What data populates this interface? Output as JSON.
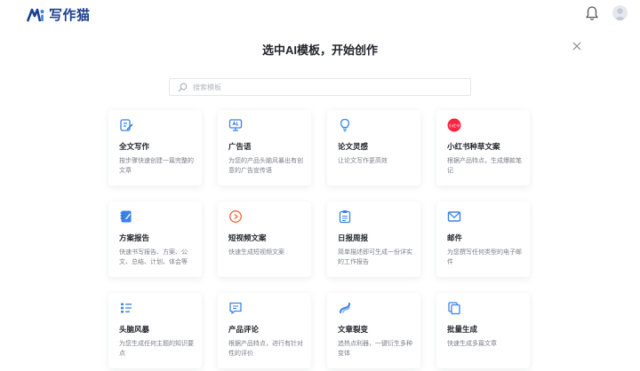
{
  "brand": {
    "name": "写作猫"
  },
  "header": {
    "icons": [
      "bell-icon",
      "user-avatar"
    ]
  },
  "dialog": {
    "title": "选中AI模板，开始创作",
    "close_icon": "close-icon"
  },
  "search": {
    "placeholder": "搜索模板",
    "value": ""
  },
  "colors": {
    "brand_blue": "#1d3f8f",
    "accent_blue": "#3b82e6",
    "card_title": "#1f2329",
    "card_desc": "#7b808a"
  },
  "templates": [
    {
      "icon": "document-edit-icon",
      "title": "全文写作",
      "desc": "按步骤快速创建一篇完整的文章"
    },
    {
      "icon": "ad-screen-icon",
      "title": "广告语",
      "desc": "为您的产品头脑风暴出有创意的广告宣传语"
    },
    {
      "icon": "lightbulb-icon",
      "title": "论文灵感",
      "desc": "让论文写作更高效"
    },
    {
      "icon": "xiaohongshu-logo-icon",
      "badge": "小红书",
      "title": "小红书种草文案",
      "desc": "根据产品特点，生成爆款笔记"
    },
    {
      "icon": "notebook-icon",
      "title": "方案报告",
      "desc": "快速书写报告、方案、公文、总结、计划、体会等"
    },
    {
      "icon": "video-play-icon",
      "title": "短视频文案",
      "desc": "快速生成短视频文案"
    },
    {
      "icon": "clipboard-icon",
      "title": "日报周报",
      "desc": "简单描述即可生成一份详实的工作报告"
    },
    {
      "icon": "mail-icon",
      "title": "邮件",
      "desc": "为您撰写任何类型的电子邮件"
    },
    {
      "icon": "brainstorm-list-icon",
      "title": "头脑风暴",
      "desc": "为您生成任何主题的知识要点"
    },
    {
      "icon": "comment-icon",
      "title": "产品评论",
      "desc": "根据产品特点，进行有针对性的评价"
    },
    {
      "icon": "fission-icon",
      "title": "文章裂变",
      "desc": "追热点利器，一键衍生多种变体"
    },
    {
      "icon": "batch-copy-icon",
      "title": "批量生成",
      "desc": "快速生成多篇文章"
    }
  ]
}
